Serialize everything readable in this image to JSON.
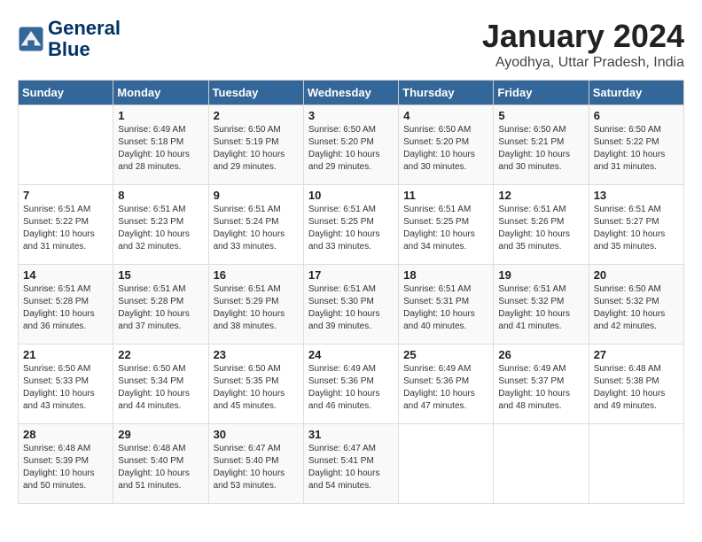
{
  "header": {
    "logo_line1": "General",
    "logo_line2": "Blue",
    "month": "January 2024",
    "location": "Ayodhya, Uttar Pradesh, India"
  },
  "weekdays": [
    "Sunday",
    "Monday",
    "Tuesday",
    "Wednesday",
    "Thursday",
    "Friday",
    "Saturday"
  ],
  "weeks": [
    [
      {
        "day": "",
        "sunrise": "",
        "sunset": "",
        "daylight": ""
      },
      {
        "day": "1",
        "sunrise": "6:49 AM",
        "sunset": "5:18 PM",
        "daylight": "10 hours and 28 minutes."
      },
      {
        "day": "2",
        "sunrise": "6:50 AM",
        "sunset": "5:19 PM",
        "daylight": "10 hours and 29 minutes."
      },
      {
        "day": "3",
        "sunrise": "6:50 AM",
        "sunset": "5:20 PM",
        "daylight": "10 hours and 29 minutes."
      },
      {
        "day": "4",
        "sunrise": "6:50 AM",
        "sunset": "5:20 PM",
        "daylight": "10 hours and 30 minutes."
      },
      {
        "day": "5",
        "sunrise": "6:50 AM",
        "sunset": "5:21 PM",
        "daylight": "10 hours and 30 minutes."
      },
      {
        "day": "6",
        "sunrise": "6:50 AM",
        "sunset": "5:22 PM",
        "daylight": "10 hours and 31 minutes."
      }
    ],
    [
      {
        "day": "7",
        "sunrise": "6:51 AM",
        "sunset": "5:22 PM",
        "daylight": "10 hours and 31 minutes."
      },
      {
        "day": "8",
        "sunrise": "6:51 AM",
        "sunset": "5:23 PM",
        "daylight": "10 hours and 32 minutes."
      },
      {
        "day": "9",
        "sunrise": "6:51 AM",
        "sunset": "5:24 PM",
        "daylight": "10 hours and 33 minutes."
      },
      {
        "day": "10",
        "sunrise": "6:51 AM",
        "sunset": "5:25 PM",
        "daylight": "10 hours and 33 minutes."
      },
      {
        "day": "11",
        "sunrise": "6:51 AM",
        "sunset": "5:25 PM",
        "daylight": "10 hours and 34 minutes."
      },
      {
        "day": "12",
        "sunrise": "6:51 AM",
        "sunset": "5:26 PM",
        "daylight": "10 hours and 35 minutes."
      },
      {
        "day": "13",
        "sunrise": "6:51 AM",
        "sunset": "5:27 PM",
        "daylight": "10 hours and 35 minutes."
      }
    ],
    [
      {
        "day": "14",
        "sunrise": "6:51 AM",
        "sunset": "5:28 PM",
        "daylight": "10 hours and 36 minutes."
      },
      {
        "day": "15",
        "sunrise": "6:51 AM",
        "sunset": "5:28 PM",
        "daylight": "10 hours and 37 minutes."
      },
      {
        "day": "16",
        "sunrise": "6:51 AM",
        "sunset": "5:29 PM",
        "daylight": "10 hours and 38 minutes."
      },
      {
        "day": "17",
        "sunrise": "6:51 AM",
        "sunset": "5:30 PM",
        "daylight": "10 hours and 39 minutes."
      },
      {
        "day": "18",
        "sunrise": "6:51 AM",
        "sunset": "5:31 PM",
        "daylight": "10 hours and 40 minutes."
      },
      {
        "day": "19",
        "sunrise": "6:51 AM",
        "sunset": "5:32 PM",
        "daylight": "10 hours and 41 minutes."
      },
      {
        "day": "20",
        "sunrise": "6:50 AM",
        "sunset": "5:32 PM",
        "daylight": "10 hours and 42 minutes."
      }
    ],
    [
      {
        "day": "21",
        "sunrise": "6:50 AM",
        "sunset": "5:33 PM",
        "daylight": "10 hours and 43 minutes."
      },
      {
        "day": "22",
        "sunrise": "6:50 AM",
        "sunset": "5:34 PM",
        "daylight": "10 hours and 44 minutes."
      },
      {
        "day": "23",
        "sunrise": "6:50 AM",
        "sunset": "5:35 PM",
        "daylight": "10 hours and 45 minutes."
      },
      {
        "day": "24",
        "sunrise": "6:49 AM",
        "sunset": "5:36 PM",
        "daylight": "10 hours and 46 minutes."
      },
      {
        "day": "25",
        "sunrise": "6:49 AM",
        "sunset": "5:36 PM",
        "daylight": "10 hours and 47 minutes."
      },
      {
        "day": "26",
        "sunrise": "6:49 AM",
        "sunset": "5:37 PM",
        "daylight": "10 hours and 48 minutes."
      },
      {
        "day": "27",
        "sunrise": "6:48 AM",
        "sunset": "5:38 PM",
        "daylight": "10 hours and 49 minutes."
      }
    ],
    [
      {
        "day": "28",
        "sunrise": "6:48 AM",
        "sunset": "5:39 PM",
        "daylight": "10 hours and 50 minutes."
      },
      {
        "day": "29",
        "sunrise": "6:48 AM",
        "sunset": "5:40 PM",
        "daylight": "10 hours and 51 minutes."
      },
      {
        "day": "30",
        "sunrise": "6:47 AM",
        "sunset": "5:40 PM",
        "daylight": "10 hours and 53 minutes."
      },
      {
        "day": "31",
        "sunrise": "6:47 AM",
        "sunset": "5:41 PM",
        "daylight": "10 hours and 54 minutes."
      },
      {
        "day": "",
        "sunrise": "",
        "sunset": "",
        "daylight": ""
      },
      {
        "day": "",
        "sunrise": "",
        "sunset": "",
        "daylight": ""
      },
      {
        "day": "",
        "sunrise": "",
        "sunset": "",
        "daylight": ""
      }
    ]
  ]
}
